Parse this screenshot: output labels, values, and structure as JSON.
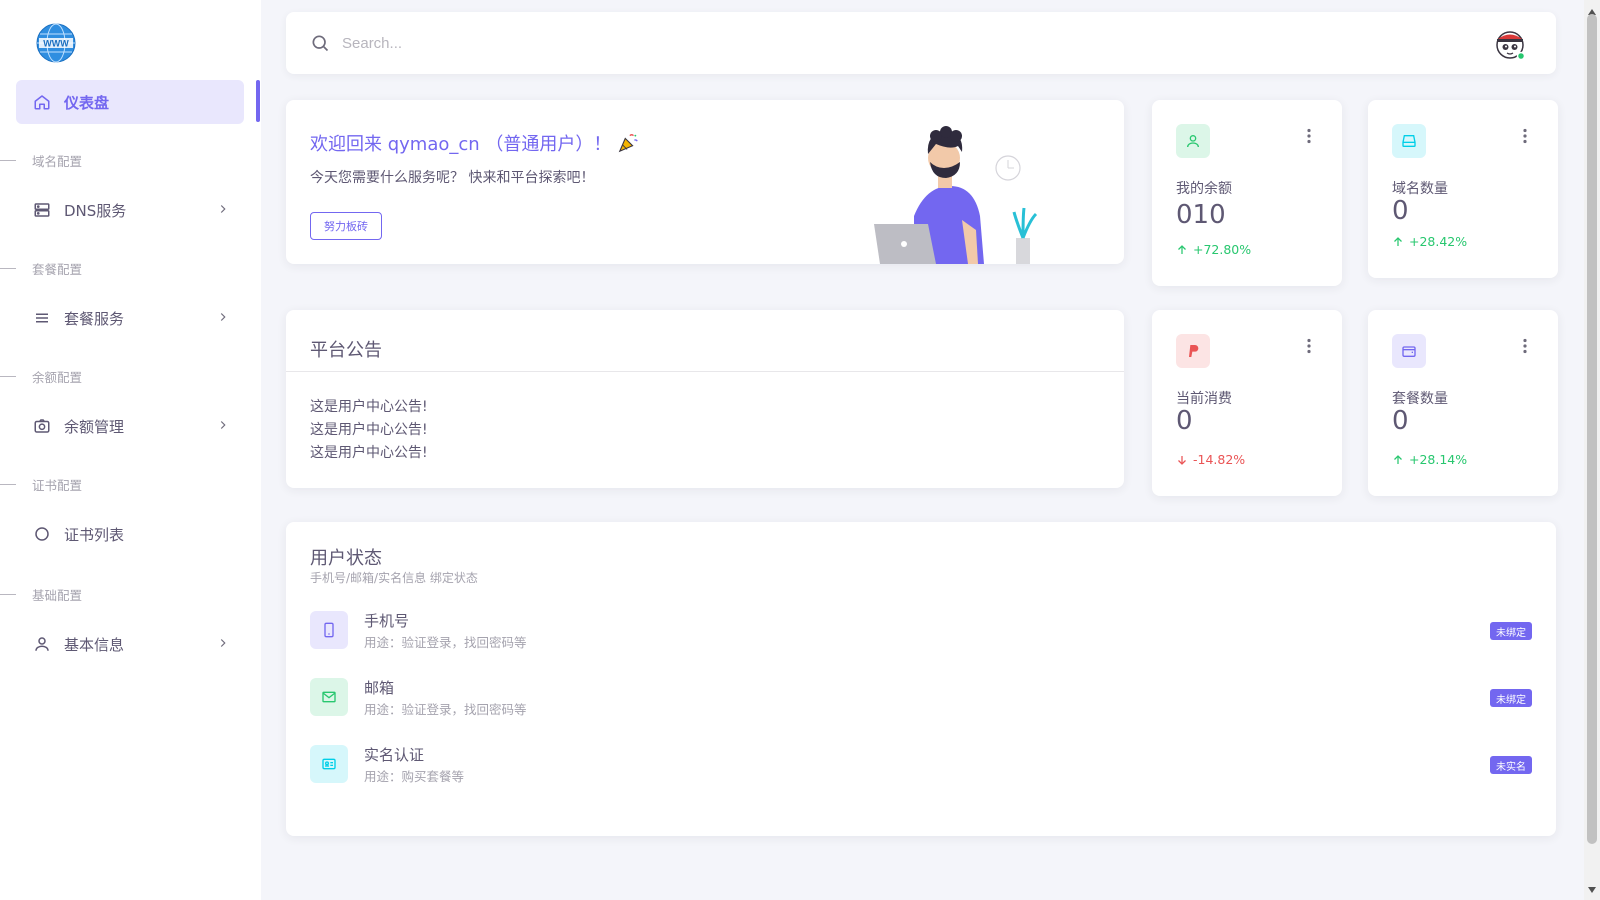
{
  "search": {
    "placeholder": "Search..."
  },
  "sidebar": {
    "active": {
      "label": "仪表盘"
    },
    "sections": [
      {
        "label": "域名配置",
        "item": "DNS服务"
      },
      {
        "label": "套餐配置",
        "item": "套餐服务"
      },
      {
        "label": "余额配置",
        "item": "余额管理"
      },
      {
        "label": "证书配置",
        "item": "证书列表"
      },
      {
        "label": "基础配置",
        "item": "基本信息"
      }
    ]
  },
  "welcome": {
    "title": "欢迎回来 qymao_cn （普通用户）！",
    "subtitle": "今天您需要什么服务呢？ 快来和平台探索吧！",
    "button": "努力板砖"
  },
  "stats": [
    {
      "label": "我的余额",
      "value": "010",
      "trend": "+72.80%",
      "direction": "up",
      "color": "#28c76f"
    },
    {
      "label": "域名数量",
      "value": "0",
      "trend": "+28.42%",
      "direction": "up",
      "color": "#00cfe8"
    },
    {
      "label": "当前消费",
      "value": "0",
      "trend": "-14.82%",
      "direction": "down",
      "color": "#ea5455"
    },
    {
      "label": "套餐数量",
      "value": "0",
      "trend": "+28.14%",
      "direction": "up",
      "color": "#7367f0"
    }
  ],
  "notice": {
    "title": "平台公告",
    "lines": [
      "这是用户中心公告!",
      "这是用户中心公告!",
      "这是用户中心公告!"
    ]
  },
  "user_status": {
    "title": "用户状态",
    "subtitle": "手机号/邮箱/实名信息 绑定状态",
    "items": [
      {
        "title": "手机号",
        "desc": "用途：验证登录，找回密码等",
        "badge": "未绑定"
      },
      {
        "title": "邮箱",
        "desc": "用途：验证登录，找回密码等",
        "badge": "未绑定"
      },
      {
        "title": "实名认证",
        "desc": "用途：购买套餐等",
        "badge": "未实名"
      }
    ]
  }
}
